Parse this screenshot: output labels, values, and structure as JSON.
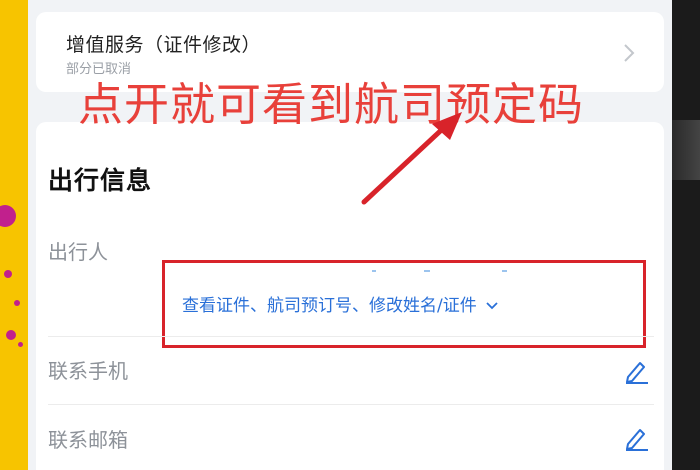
{
  "service": {
    "title": "增值服务（证件修改）",
    "subtitle": "部分已取消"
  },
  "annotation": {
    "text": "点开就可看到航司预定码",
    "color": "#e8403a"
  },
  "travel_info": {
    "section_title": "出行信息",
    "passenger_label": "出行人",
    "toggle_link": "查看证件、航司预订号、修改姓名/证件",
    "phone_label": "联系手机",
    "email_label": "联系邮箱"
  },
  "colors": {
    "accent_blue": "#2a70d8",
    "highlight_red": "#d8232a"
  },
  "icons": [
    "chevron-right-icon",
    "chevron-down-icon",
    "pencil-edit-icon",
    "annotation-arrow"
  ]
}
